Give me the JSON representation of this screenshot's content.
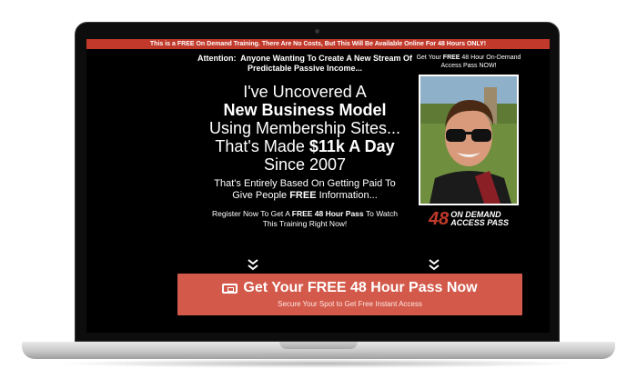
{
  "banner": {
    "text_before": "This is a ",
    "free": "FREE",
    "text_after": " On Demand Training. There Are No Costs, But This Will Be Available Online For ",
    "hours": "48 Hours ONLY!"
  },
  "attention": {
    "label": "Attention:",
    "line1": "Anyone Wanting To Create A New Stream Of",
    "line2": "Predictable Passive Income..."
  },
  "headline": {
    "line1": "I've Uncovered A",
    "line2": "New Business Model",
    "line3": "Using Membership Sites...",
    "line4_a": "That's Made ",
    "line4_b": "$11k A Day",
    "line5": "Since 2007"
  },
  "subhead": {
    "line1": "That's Entirely Based On Getting Paid To",
    "line2_a": "Give People ",
    "line2_b": "FREE",
    "line2_c": " Information..."
  },
  "register": {
    "line1_a": "Register Now To Get A ",
    "line1_b": "FREE 48 Hour Pass",
    "line1_c": " To Watch",
    "line2": "This Training Right Now!"
  },
  "sidebar": {
    "line1_a": "Get Your ",
    "line1_b": "FREE",
    "line1_c": " 48 Hour On-Demand",
    "line2": "Access Pass NOW!",
    "badge_num": "48",
    "badge_line1": "ON DEMAND",
    "badge_line2": "ACCESS PASS"
  },
  "cta": {
    "label": "Get Your FREE 48 Hour Pass Now",
    "sub": "Secure Your Spot to Get Free Instant Access"
  },
  "colors": {
    "accent": "#c0392b",
    "cta": "#d35a4a"
  },
  "icons": {
    "cta_icon": "ticket-icon",
    "chevron": "double-chevron-down-icon"
  }
}
